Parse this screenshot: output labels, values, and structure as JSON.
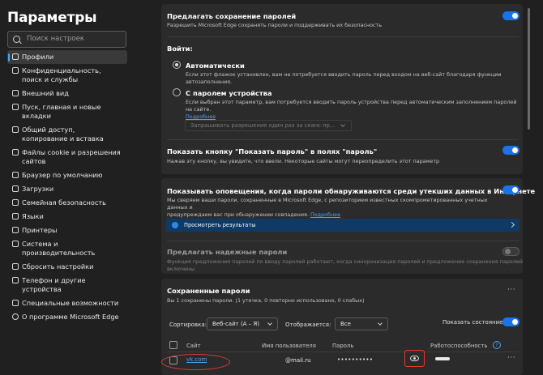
{
  "sidebar": {
    "title": "Параметры",
    "search_placeholder": "Поиск настроек",
    "items": [
      {
        "label": "Профили",
        "active": true
      },
      {
        "label": "Конфиденциальность, поиск и службы"
      },
      {
        "label": "Внешний вид"
      },
      {
        "label": "Пуск, главная и новые вкладки"
      },
      {
        "label": "Общий доступ, копирование и вставка"
      },
      {
        "label": "Файлы cookie и разрешения сайтов"
      },
      {
        "label": "Браузер по умолчанию"
      },
      {
        "label": "Загрузки"
      },
      {
        "label": "Семейная безопасность"
      },
      {
        "label": "Языки"
      },
      {
        "label": "Принтеры"
      },
      {
        "label": "Система и производительность"
      },
      {
        "label": "Сбросить настройки"
      },
      {
        "label": "Телефон и другие устройства"
      },
      {
        "label": "Специальные возможности"
      },
      {
        "label": "О программе Microsoft Edge"
      }
    ]
  },
  "offer_save": {
    "title": "Предлагать сохранение паролей",
    "desc": "Разрешить Microsoft Edge сохранять пароли и поддерживать их безопасность",
    "enabled": true
  },
  "signin": {
    "label": "Войти:",
    "auto_title": "Автоматически",
    "auto_desc": "Если этот флажок установлен, вам не потребуется вводить пароль перед входом на веб-сайт благодаря функции автозаполнения.",
    "device_title": "С паролем устройства",
    "device_desc": "Если выбран этот параметр, вам потребуется вводить пароль устройства перед автоматическим заполнением паролей на сайте.",
    "device_link": "Подробнее",
    "select_value": "Запрашивать разрешение один раз за сеанс пр..."
  },
  "show_password_button": {
    "title": "Показать кнопку \"Показать пароль\" в полях \"пароль\"",
    "desc": "Нажав эту кнопку, вы увидите, что ввели. Некоторые сайты могут переопределить этот параметр",
    "enabled": true
  },
  "leak_alerts": {
    "title": "Показывать оповещения, когда пароли обнаруживаются среди утекших данных в Интернете",
    "desc_line1": "Мы сверяем ваши пароли, сохраненные в Microsoft Edge, с репозиторием известных скомпрометированных учетных данных и",
    "desc_line2": "предупреждаем вас при обнаружении совпадения.",
    "link": "Подробнее",
    "results_label": "Просмотреть результаты",
    "enabled": true
  },
  "strong_passwords": {
    "title": "Предлагать надежные пароли",
    "desc": "Функция предложения паролей по вводу паролей работают, когда синхронизация паролей и предложение сохранения паролей включены",
    "enabled": false
  },
  "saved_passwords": {
    "title": "Сохраненные пароли",
    "summary": "Вы 1 сохранены пароли. (1 утечка, 0 повторно использовано, 0 слабых)",
    "more": "···",
    "sort_label": "Сортировка:",
    "sort_value": "Веб-сайт (А – Я)",
    "display_label": "Отображается:",
    "display_value": "Все",
    "show_health_label": "Показать состояние",
    "show_health_enabled": true,
    "columns": {
      "site": "Сайт",
      "username": "Имя пользователя",
      "password": "Пароль",
      "health": "Работоспособность",
      "help": "?"
    },
    "rows": [
      {
        "site": "vk.com",
        "username": "@mail.ru",
        "password": "••••••••••",
        "more": "···"
      }
    ]
  }
}
